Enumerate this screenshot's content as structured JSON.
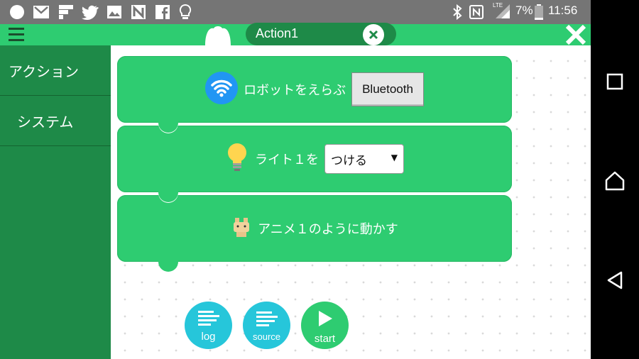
{
  "status_bar": {
    "battery": "7%",
    "time": "11:56",
    "network_label": "LTE"
  },
  "top_bar": {
    "tab_title": "Action1"
  },
  "sidebar": {
    "items": [
      {
        "label": "アクション"
      },
      {
        "label": "システム"
      }
    ]
  },
  "blocks": {
    "robot": {
      "label": "ロボットをえらぶ",
      "button_label": "Bluetooth",
      "icon": "wifi-icon"
    },
    "light": {
      "label": "ライト１を",
      "selected": "つける",
      "icon": "lightbulb-icon"
    },
    "anime": {
      "label": "アニメ１のように動かす",
      "icon": "bunny-robot-icon"
    }
  },
  "bottom_buttons": {
    "log": "log",
    "source": "source",
    "start": "start"
  },
  "colors": {
    "accent": "#2ecc71",
    "dark_green": "#1e8a48",
    "cyan": "#26c6da",
    "wifi_blue": "#2196f3"
  }
}
